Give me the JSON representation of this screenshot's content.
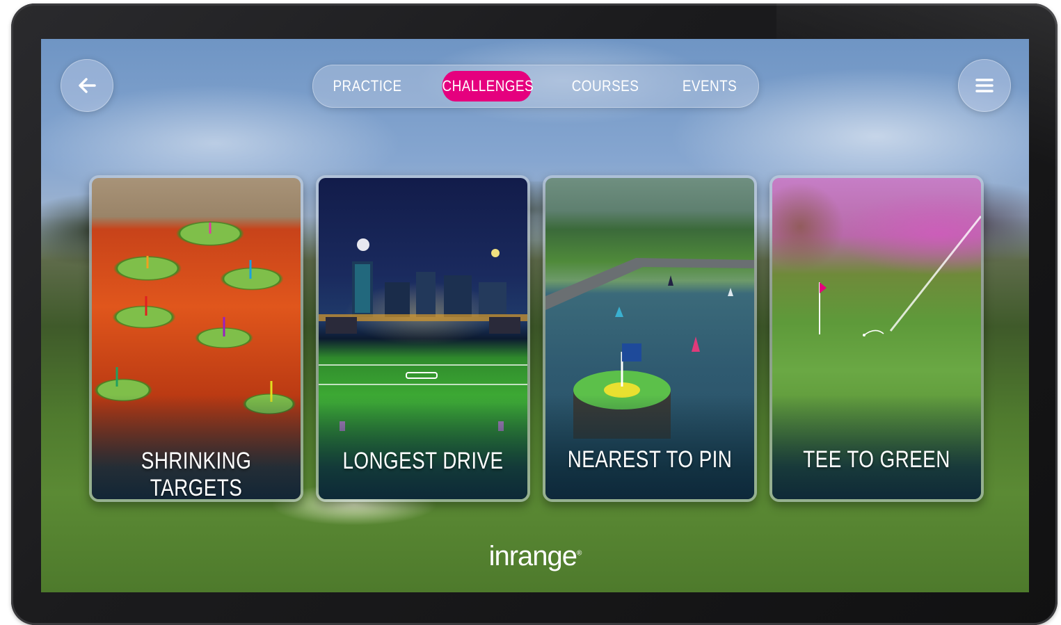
{
  "nav": {
    "back_icon": "arrow-left-icon",
    "menu_icon": "hamburger-menu-icon"
  },
  "tabs": [
    {
      "label": "PRACTICE",
      "active": false
    },
    {
      "label": "CHALLENGES",
      "active": true
    },
    {
      "label": "COURSES",
      "active": false
    },
    {
      "label": "EVENTS",
      "active": false
    }
  ],
  "cards": [
    {
      "title": "SHRINKING TARGETS"
    },
    {
      "title": "LONGEST DRIVE"
    },
    {
      "title": "NEAREST TO PIN"
    },
    {
      "title": "TEE TO GREEN"
    }
  ],
  "brand": {
    "logo_text": "inrange",
    "logo_mark": "®"
  },
  "colors": {
    "accent": "#e5007e",
    "card_title": "#ffffff"
  }
}
